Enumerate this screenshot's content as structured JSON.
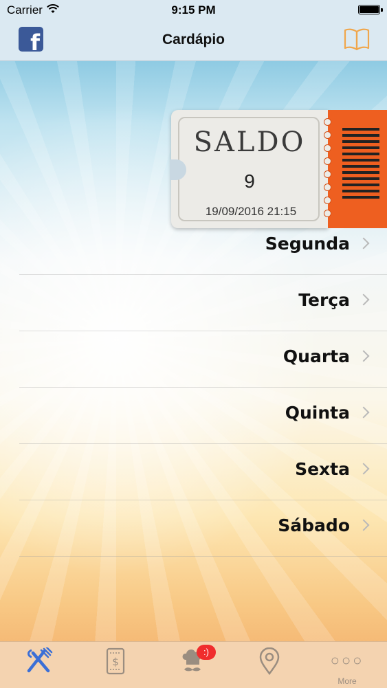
{
  "status_bar": {
    "carrier": "Carrier",
    "time": "9:15 PM"
  },
  "nav": {
    "title": "Cardápio",
    "facebook_glyph": "f",
    "book_icon": "book-icon"
  },
  "ticket": {
    "label": "SALDO",
    "value": "9",
    "date": "19/09/2016 21:15"
  },
  "days": [
    {
      "label": "Segunda"
    },
    {
      "label": "Terça"
    },
    {
      "label": "Quarta"
    },
    {
      "label": "Quinta"
    },
    {
      "label": "Sexta"
    },
    {
      "label": "Sábado"
    }
  ],
  "tabs": [
    {
      "icon": "fork-knife-icon",
      "label": "",
      "active": true
    },
    {
      "icon": "receipt-icon",
      "label": ""
    },
    {
      "icon": "chef-icon",
      "label": "",
      "badge": ":)"
    },
    {
      "icon": "location-pin-icon",
      "label": ""
    },
    {
      "icon": "more-icon",
      "label": "More",
      "glyph": "○○○"
    }
  ],
  "colors": {
    "accent": "#3b6fd6",
    "ticket_stub": "#ee5f20",
    "tab_bar": "#f4d3b0",
    "badge": "#f02d2d",
    "book_icon": "#f0a64b"
  }
}
